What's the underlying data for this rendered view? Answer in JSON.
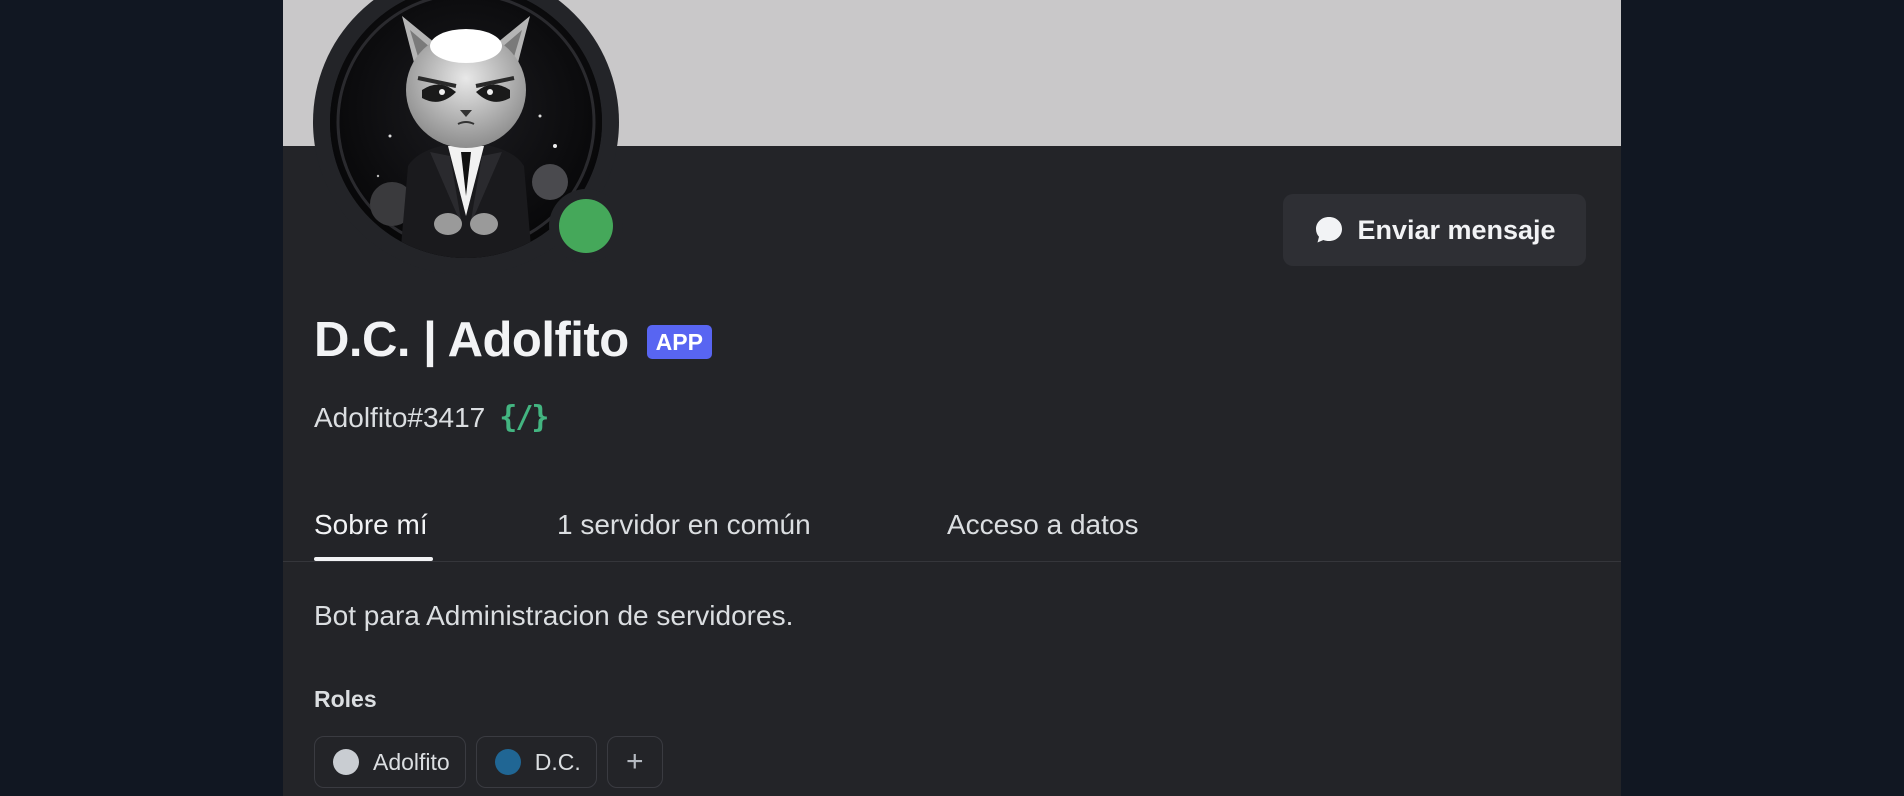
{
  "profile": {
    "display_name": "D.C. | Adolfito",
    "badge": "APP",
    "username": "Adolfito#3417",
    "slash_badge": "{/}",
    "status": "online",
    "avatar_alt": "cat-in-suit-avatar"
  },
  "actions": {
    "send_message_label": "Enviar mensaje"
  },
  "tabs": [
    {
      "label": "Sobre mí",
      "active": true
    },
    {
      "label": "1 servidor en común",
      "active": false
    },
    {
      "label": "Acceso a datos",
      "active": false
    }
  ],
  "about": {
    "bio": "Bot para Administracion de servidores.",
    "roles_heading": "Roles",
    "roles": [
      {
        "name": "Adolfito",
        "color": "#c9cdd2"
      },
      {
        "name": "D.C.",
        "color": "#206694"
      }
    ],
    "add_role_label": "+"
  },
  "colors": {
    "banner": "#c9c8c9",
    "status_online": "#45a85a",
    "app_badge": "#5865f2",
    "modal_bg": "#232428"
  }
}
